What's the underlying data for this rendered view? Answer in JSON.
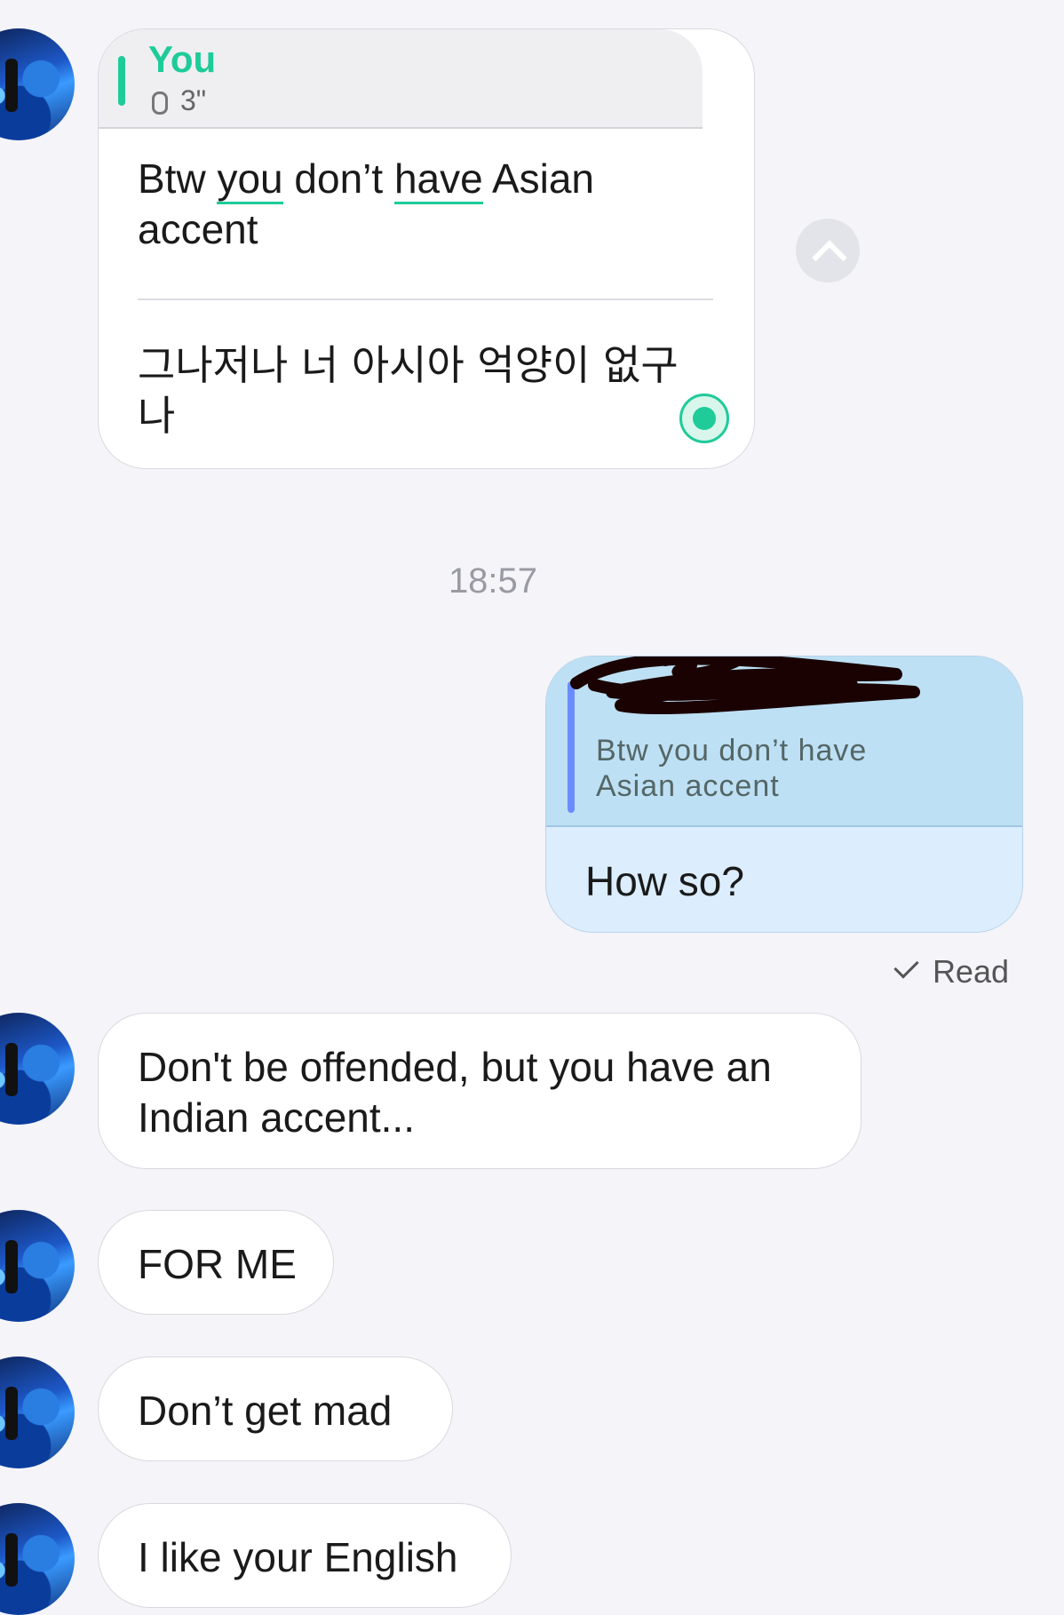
{
  "messages": {
    "voice_reply": {
      "quote_sender": "You",
      "quote_duration": "3\"",
      "transcript_pre": "Btw ",
      "transcript_word1": "you",
      "transcript_mid": " don’t ",
      "transcript_word2": "have",
      "transcript_post": " Asian accent",
      "translation": "그나저나 너 아시아 억양이 없구나"
    },
    "timestamp": "18:57",
    "outgoing": {
      "quoted_text": "Btw you don’t have Asian accent",
      "reply": "How so?",
      "status": "Read"
    },
    "incoming": [
      "Don't be offended, but you have an Indian accent...",
      "FOR ME",
      "Don’t get mad",
      "I like your English"
    ]
  },
  "icons": [
    "avatar",
    "microphone-icon",
    "translate-badge-icon",
    "scroll-up-icon",
    "read-check-icon"
  ],
  "colors": {
    "accent_green": "#1ecb99",
    "outgoing_bubble": "#dcedfd",
    "outgoing_quote": "#bde0f4",
    "quote_bar_blue": "#6b8cff",
    "background": "#f4f4f9"
  }
}
